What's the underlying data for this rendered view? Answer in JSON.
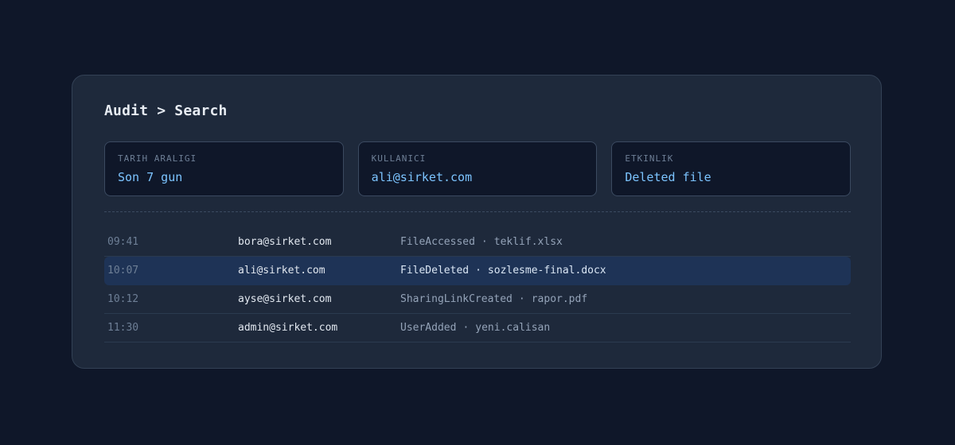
{
  "header": {
    "title": "Audit > Search"
  },
  "filters": [
    {
      "label": "TARIH ARALIGI",
      "value": "Son 7 gun"
    },
    {
      "label": "KULLANICI",
      "value": "ali@sirket.com"
    },
    {
      "label": "ETKINLIK",
      "value": "Deleted file"
    }
  ],
  "results": [
    {
      "time": "09:41",
      "user": "bora@sirket.com",
      "event": "FileAccessed",
      "target": "teklif.xlsx"
    },
    {
      "time": "10:07",
      "user": "ali@sirket.com",
      "event": "FileDeleted",
      "target": "sozlesme-final.docx",
      "selected": true
    },
    {
      "time": "10:12",
      "user": "ayse@sirket.com",
      "event": "SharingLinkCreated",
      "target": "rapor.pdf"
    },
    {
      "time": "11:30",
      "user": "admin@sirket.com",
      "event": "UserAdded",
      "target": "yeni.calisan"
    }
  ],
  "separator": "·",
  "colors": {
    "background": "#0f1729",
    "panel": "#1e293b",
    "accent": "#7cc4ff",
    "selected_row": "#1e3356"
  }
}
